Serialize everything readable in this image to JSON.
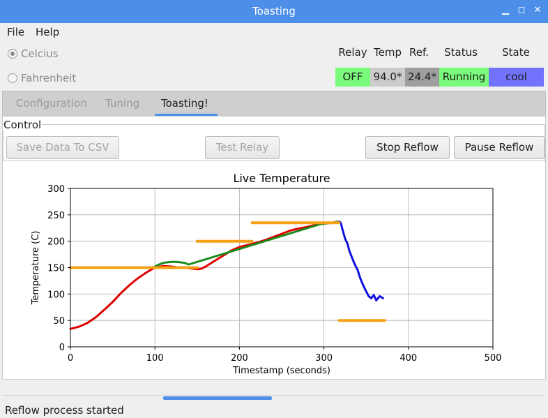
{
  "window": {
    "title": "Toasting"
  },
  "menu": {
    "file": "File",
    "help": "Help"
  },
  "units": {
    "celsius": "Celcius",
    "fahrenheit": "Fahrenheit",
    "selected": "celsius"
  },
  "readouts": {
    "headers": {
      "relay": "Relay",
      "temp": "Temp",
      "ref": "Ref.",
      "status": "Status",
      "state": "State"
    },
    "values": {
      "relay": "OFF",
      "temp": "94.0*",
      "ref": "24.4*",
      "status": "Running",
      "state": "cool"
    },
    "colors": {
      "relay": "#7bfb7b",
      "temp": "#cccccc",
      "ref": "#9e9e9e",
      "status": "#7bfb7b",
      "state": "#7272fc"
    }
  },
  "tabs": [
    {
      "label": "Configuration",
      "active": false
    },
    {
      "label": "Tuning",
      "active": false
    },
    {
      "label": "Toasting!",
      "active": true
    }
  ],
  "control": {
    "group_label": "Control",
    "save_csv": "Save Data To CSV",
    "test_relay": "Test Relay",
    "stop_reflow": "Stop Reflow",
    "pause_reflow": "Pause Reflow"
  },
  "status_bar": {
    "message": "Reflow process started",
    "progress": 0.2
  },
  "chart_data": {
    "type": "line",
    "title": "Live Temperature",
    "xlabel": "Timestamp (seconds)",
    "ylabel": "Temperature (C)",
    "xlim": [
      0,
      500
    ],
    "ylim": [
      0,
      300
    ],
    "xticks": [
      0,
      100,
      200,
      300,
      400,
      500
    ],
    "yticks": [
      0,
      50,
      100,
      150,
      200,
      250,
      300
    ],
    "grid": true,
    "series": [
      {
        "color": "#e00000",
        "x": [
          0,
          10,
          20,
          30,
          40,
          50,
          60,
          70,
          80,
          90,
          100,
          110,
          120,
          130,
          140,
          150,
          155,
          160,
          170,
          180,
          190,
          200,
          210,
          220,
          230,
          240,
          250,
          260,
          270,
          280,
          290,
          295
        ],
        "y": [
          34,
          38,
          45,
          56,
          70,
          85,
          102,
          117,
          130,
          141,
          150,
          153,
          152,
          150,
          149,
          147,
          148,
          152,
          162,
          172,
          182,
          189,
          193,
          197,
          202,
          208,
          214,
          220,
          224,
          227,
          231,
          233
        ]
      },
      {
        "color": "#1a8a1a",
        "x": [
          100,
          105,
          110,
          115,
          120,
          125,
          130,
          135,
          140,
          295,
          300,
          305,
          310,
          315,
          318
        ],
        "y": [
          152,
          156,
          159,
          160,
          161,
          161,
          160,
          159,
          156,
          232,
          233,
          234,
          235,
          237,
          237
        ]
      },
      {
        "color": "#1010e0",
        "x": [
          318,
          320,
          322,
          325,
          328,
          330,
          333,
          336,
          340,
          343,
          346,
          350,
          353,
          356,
          359,
          362,
          366,
          370
        ],
        "y": [
          237,
          235,
          222,
          205,
          195,
          182,
          170,
          158,
          145,
          130,
          118,
          105,
          96,
          92,
          98,
          88,
          96,
          92
        ]
      },
      {
        "color": "#f5a017",
        "segments": [
          {
            "x": [
              0,
              150
            ],
            "y": [
              150,
              150
            ]
          },
          {
            "x": [
              150,
              215
            ],
            "y": [
              200,
              200
            ]
          },
          {
            "x": [
              215,
              318
            ],
            "y": [
              235,
              235
            ]
          },
          {
            "x": [
              318,
              372
            ],
            "y": [
              50,
              50
            ]
          }
        ]
      }
    ]
  }
}
